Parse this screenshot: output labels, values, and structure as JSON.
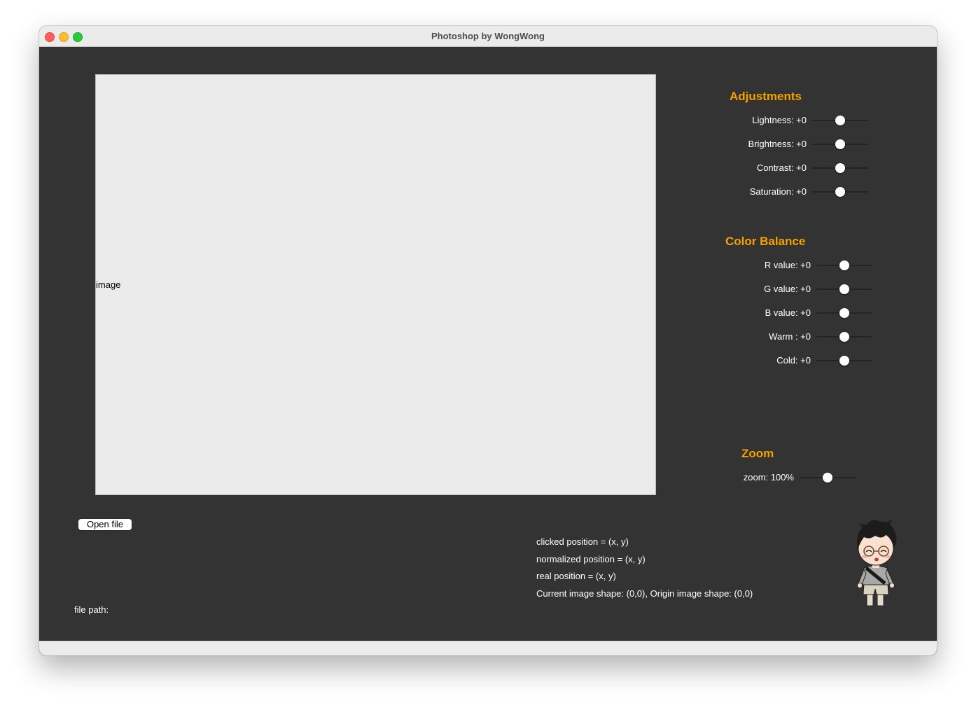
{
  "window": {
    "title": "Photoshop by WongWong"
  },
  "canvas": {
    "label": "image"
  },
  "adjustments": {
    "title": "Adjustments",
    "items": [
      {
        "label": "Lightness: +0",
        "value": 0
      },
      {
        "label": "Brightness: +0",
        "value": 0
      },
      {
        "label": "Contrast: +0",
        "value": 0
      },
      {
        "label": "Saturation: +0",
        "value": 0
      }
    ]
  },
  "color_balance": {
    "title": "Color Balance",
    "items": [
      {
        "label": "R value: +0",
        "value": 0
      },
      {
        "label": "G value: +0",
        "value": 0
      },
      {
        "label": "B value: +0",
        "value": 0
      },
      {
        "label": "Warm : +0",
        "value": 0
      },
      {
        "label": "Cold: +0",
        "value": 0
      }
    ]
  },
  "zoom": {
    "title": "Zoom",
    "label": "zoom: 100%",
    "value": 100
  },
  "open_file_label": "Open file",
  "file_path_label": "file path:",
  "info": {
    "clicked": "clicked position = (x, y)",
    "normalized": "normalized position = (x, y)",
    "real": "real position = (x, y)",
    "shape": "Current image shape: (0,0), Origin image shape: (0,0)"
  },
  "colors": {
    "accent": "#f5a200",
    "panel_bg": "#333333",
    "canvas_bg": "#ebebeb"
  }
}
